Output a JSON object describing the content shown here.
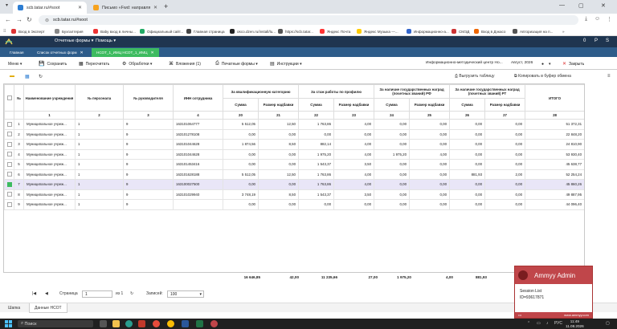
{
  "browser": {
    "tabs": [
      {
        "title": "scb.tatar.ru/#soot",
        "active": true,
        "color": "#2d7dd2"
      },
      {
        "title": "Письмо «Fwd: направляю пре...",
        "active": false,
        "color": "#f6a21e"
      }
    ],
    "url": "scb.tatar.ru/#soot",
    "bookmarks": [
      {
        "label": "Вход в Эксперт",
        "color": "#d33"
      },
      {
        "label": "Бухгалтерия",
        "color": "#888"
      },
      {
        "label": "Baby вход в личны...",
        "color": "#e33"
      },
      {
        "label": "Официальный сайт...",
        "color": "#2a6"
      },
      {
        "label": "Главная страница",
        "color": "#444"
      },
      {
        "label": "osco.dzen.ru/install/lu...",
        "color": "#222"
      },
      {
        "label": "https://scb.tatar...",
        "color": "#555"
      },
      {
        "label": "Яндекс Почта",
        "color": "#f33"
      },
      {
        "label": "Яндекс Музыка —...",
        "color": "#fc0"
      },
      {
        "label": "Информационно-а...",
        "color": "#36c"
      },
      {
        "label": "СМЭД",
        "color": "#c33"
      },
      {
        "label": "Вход в Дэкасо",
        "color": "#e60"
      },
      {
        "label": "Авторизация на п...",
        "color": "#555"
      }
    ]
  },
  "app": {
    "menus": [
      "Отчетные формы",
      "Помощь"
    ],
    "right_icons": [
      "0",
      "P",
      "S"
    ]
  },
  "doc_tabs": [
    {
      "label": "Главная",
      "active": false
    },
    {
      "label": "Список отчетных форм",
      "active": false
    },
    {
      "label": "НСОТ_1_ИМЦ НСОТ_1_ИМЦ",
      "active": true
    }
  ],
  "toolbar": {
    "menu": "Меню",
    "save": "Сохранить",
    "recalc": "Пересчитать",
    "processing": "Обработки",
    "attachments": "Вложения (1)",
    "print": "Печатные формы",
    "instructions": "Инструкции",
    "org": "Информационно-методический центр Но...",
    "period": "Август, 2026",
    "close": "Закрыть"
  },
  "subtoolbar": {
    "export": "Выгрузить таблицу",
    "copy": "Копировать в буфер обмена"
  },
  "table": {
    "headers": {
      "num": "№",
      "inst": "Наименование учреждения",
      "staff": "№ персонала",
      "head": "№ руководителя",
      "inn": "ИНН сотрудника",
      "qual": "За квалификационную категорию",
      "exp": "За стаж работы по профилю",
      "awrf": "За наличие государственных наград (почетных званий) РФ",
      "awrt": "За наличие государственных наград (почетных званий) РТ",
      "total": "ИТОГО",
      "sum": "Сумма",
      "pct": "Размер надбавки"
    },
    "col_numbers": [
      "1",
      "2",
      "3",
      "4",
      "20",
      "21",
      "22",
      "23",
      "24",
      "25",
      "26",
      "27",
      "28"
    ],
    "rows": [
      {
        "n": "1",
        "inst": "Муниципальное учреж...",
        "staff": "1",
        "head": "9",
        "inn": "163101064777",
        "q_sum": "5 512,05",
        "q_pct": "12,50",
        "e_sum": "1 763,86",
        "e_pct": "4,00",
        "rf_sum": "0,00",
        "rf_pct": "0,00",
        "rt_sum": "0,00",
        "rt_pct": "0,00",
        "total": "51 372,31",
        "selected": false
      },
      {
        "n": "2",
        "inst": "Муниципальное учреж...",
        "staff": "1",
        "head": "9",
        "inn": "163101278108",
        "q_sum": "0,00",
        "q_pct": "0,00",
        "e_sum": "0,00",
        "e_pct": "0,00",
        "rf_sum": "0,00",
        "rf_pct": "0,00",
        "rt_sum": "0,00",
        "rt_pct": "0,00",
        "total": "22 848,20",
        "selected": false
      },
      {
        "n": "3",
        "inst": "Муниципальное учреж...",
        "staff": "1",
        "head": "9",
        "inn": "163101044628",
        "q_sum": "1 874,56",
        "q_pct": "8,50",
        "e_sum": "882,14",
        "e_pct": "4,00",
        "rf_sum": "0,00",
        "rf_pct": "0,00",
        "rt_sum": "0,00",
        "rt_pct": "0,00",
        "total": "24 810,90",
        "selected": false
      },
      {
        "n": "4",
        "inst": "Муниципальное учреж...",
        "staff": "1",
        "head": "9",
        "inn": "163101044628",
        "q_sum": "0,00",
        "q_pct": "0,00",
        "e_sum": "1 975,20",
        "e_pct": "4,00",
        "rf_sum": "1 975,20",
        "rf_pct": "4,00",
        "rt_sum": "0,00",
        "rt_pct": "0,00",
        "total": "53 930,40",
        "selected": false
      },
      {
        "n": "5",
        "inst": "Муниципальное учреж...",
        "staff": "1",
        "head": "9",
        "inn": "163101453416",
        "q_sum": "0,00",
        "q_pct": "0,00",
        "e_sum": "1 543,37",
        "e_pct": "3,50",
        "rf_sum": "0,00",
        "rf_pct": "0,00",
        "rt_sum": "0,00",
        "rt_pct": "0,00",
        "total": "45 638,77",
        "selected": false
      },
      {
        "n": "6",
        "inst": "Муниципальное учреж...",
        "staff": "1",
        "head": "9",
        "inn": "163101628188",
        "q_sum": "5 512,05",
        "q_pct": "12,50",
        "e_sum": "1 763,86",
        "e_pct": "4,00",
        "rf_sum": "0,00",
        "rf_pct": "0,00",
        "rt_sum": "881,93",
        "rt_pct": "2,00",
        "total": "52 254,24",
        "selected": false
      },
      {
        "n": "7",
        "inst": "Муниципальное учреж...",
        "staff": "1",
        "head": "9",
        "inn": "163100027500",
        "q_sum": "0,00",
        "q_pct": "0,00",
        "e_sum": "1 763,86",
        "e_pct": "4,00",
        "rf_sum": "0,00",
        "rf_pct": "0,00",
        "rt_sum": "0,00",
        "rt_pct": "0,00",
        "total": "45 860,26",
        "selected": true
      },
      {
        "n": "8",
        "inst": "Муниципальное учреж...",
        "staff": "1",
        "head": "9",
        "inn": "163101029940",
        "q_sum": "3 748,19",
        "q_pct": "8,50",
        "e_sum": "1 543,37",
        "e_pct": "3,50",
        "rf_sum": "0,00",
        "rf_pct": "0,00",
        "rt_sum": "0,00",
        "rt_pct": "0,00",
        "total": "49 887,95",
        "selected": false
      },
      {
        "n": "9",
        "inst": "Муниципальное учреж...",
        "staff": "1",
        "head": "9",
        "inn": "",
        "q_sum": "0,00",
        "q_pct": "0,00",
        "e_sum": "0,00",
        "e_pct": "0,00",
        "rf_sum": "0,00",
        "rf_pct": "0,00",
        "rt_sum": "0,00",
        "rt_pct": "0,00",
        "total": "44 096,40",
        "selected": false
      }
    ],
    "totals": {
      "q_sum": "16 646,85",
      "q_pct": "42,00",
      "e_sum": "11 235,66",
      "e_pct": "27,00",
      "rf_sum": "1 975,20",
      "rf_pct": "4,00",
      "rt_sum": "881,93",
      "rt_pct": "2,00"
    }
  },
  "pager": {
    "page_label": "Страница",
    "page": "1",
    "of": "из 1",
    "records_label": "Записей:",
    "records": "100"
  },
  "sheets": [
    "Шапка",
    "Данные НСОТ"
  ],
  "ammyy": {
    "title": "Ammyy Admin",
    "session": "Session List",
    "id": "ID=93617871",
    "footer": "www.ammyy.com"
  },
  "taskbar": {
    "search": "Поиск",
    "lang": "РУС",
    "time": "11:49",
    "date": "11.08.2026"
  }
}
